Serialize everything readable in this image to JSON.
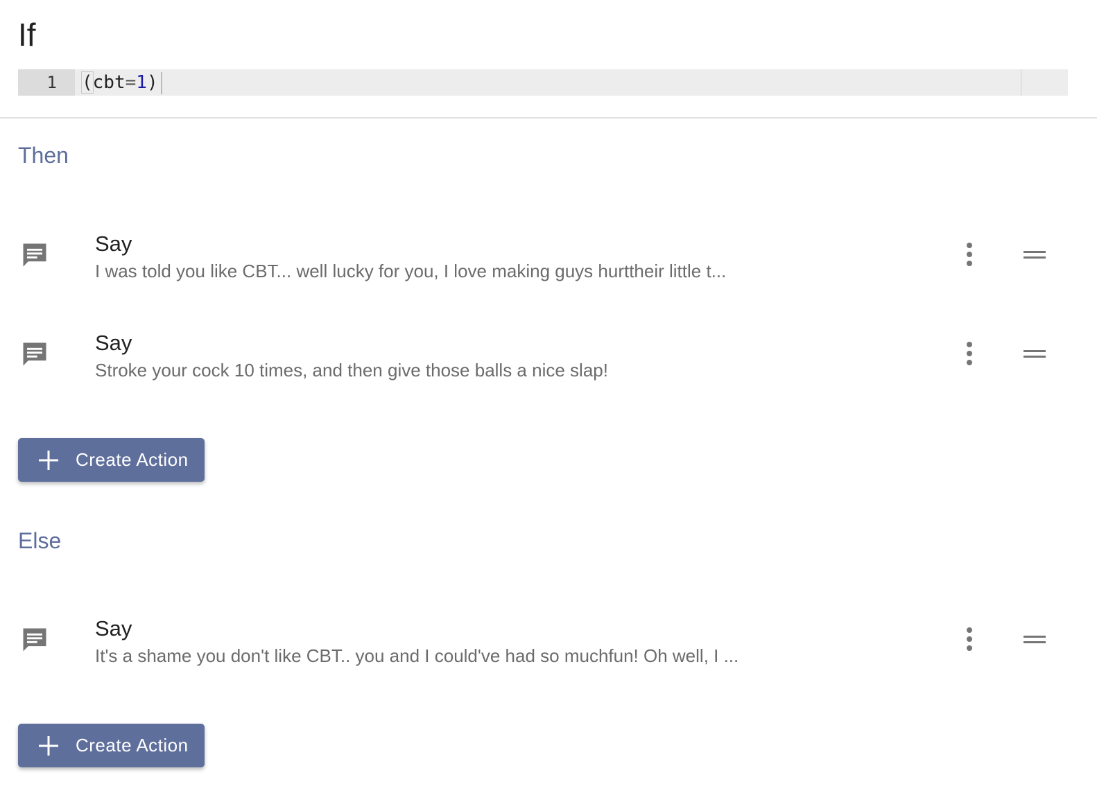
{
  "if_block": {
    "title": "If",
    "code": {
      "line_number": "1",
      "open_paren": "(",
      "identifier": "cbt",
      "operator": "=",
      "number": "1",
      "close_paren": ")"
    }
  },
  "then_section": {
    "label": "Then",
    "actions": [
      {
        "title": "Say",
        "text": "I was told you like CBT... well lucky for you, I love making guys hurttheir little t...",
        "icon": "message-icon"
      },
      {
        "title": "Say",
        "text": "Stroke your cock 10 times, and then give those balls a nice slap!",
        "icon": "message-icon"
      }
    ],
    "create_button_label": "Create Action"
  },
  "else_section": {
    "label": "Else",
    "actions": [
      {
        "title": "Say",
        "text": "It's a shame you don't like CBT.. you and I could've had so muchfun! Oh well, I ...",
        "icon": "message-icon"
      }
    ],
    "create_button_label": "Create Action"
  },
  "colors": {
    "accent": "#5f6f9c",
    "section_label": "#5d6e9c",
    "icon": "#757575"
  }
}
